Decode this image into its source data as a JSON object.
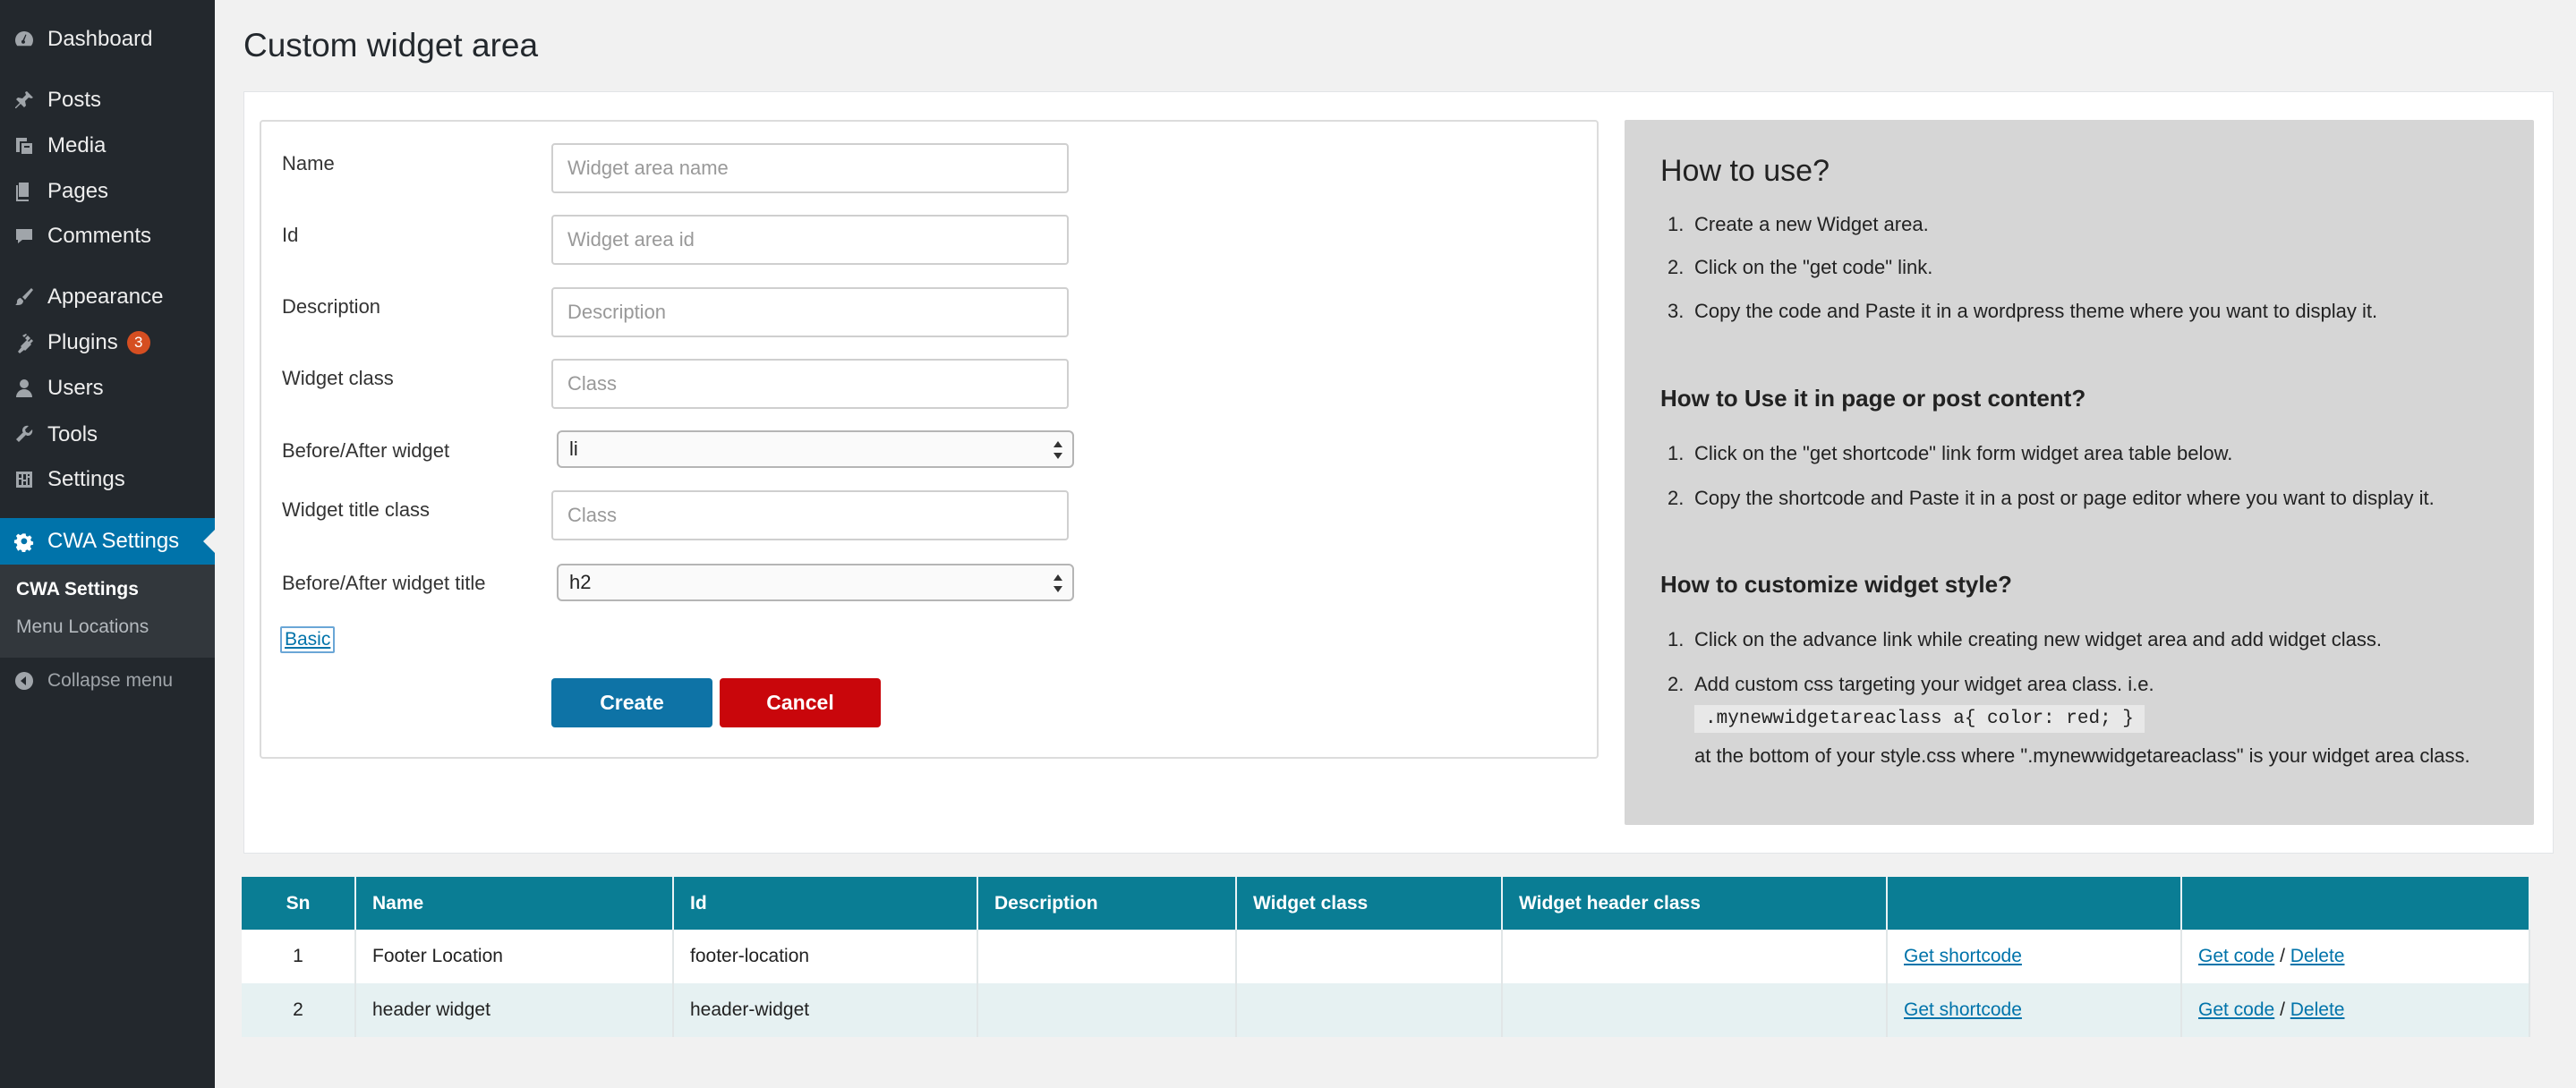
{
  "sidebar": {
    "items": [
      {
        "label": "Dashboard",
        "icon": "dashboard-icon"
      },
      {
        "label": "Posts",
        "icon": "pin-icon"
      },
      {
        "label": "Media",
        "icon": "media-icon"
      },
      {
        "label": "Pages",
        "icon": "pages-icon"
      },
      {
        "label": "Comments",
        "icon": "comment-icon"
      },
      {
        "label": "Appearance",
        "icon": "brush-icon"
      },
      {
        "label": "Plugins",
        "icon": "plugin-icon",
        "badge": "3"
      },
      {
        "label": "Users",
        "icon": "user-icon"
      },
      {
        "label": "Tools",
        "icon": "wrench-icon"
      },
      {
        "label": "Settings",
        "icon": "settings-icon"
      },
      {
        "label": "CWA Settings",
        "icon": "gear-icon"
      }
    ],
    "submenu": [
      "CWA Settings",
      "Menu Locations"
    ],
    "collapse_label": "Collapse menu",
    "accent_color": "#0073aa",
    "badge_color": "#d54e21"
  },
  "page": {
    "title": "Custom widget area"
  },
  "form": {
    "fields": [
      {
        "label": "Name",
        "placeholder": "Widget area name"
      },
      {
        "label": "Id",
        "placeholder": "Widget area id"
      },
      {
        "label": "Description",
        "placeholder": "Description"
      },
      {
        "label": "Widget class",
        "placeholder": "Class"
      },
      {
        "label": "Before/After widget",
        "value": "li"
      },
      {
        "label": "Widget title class",
        "placeholder": "Class"
      },
      {
        "label": "Before/After widget title",
        "value": "h2"
      }
    ],
    "basic_link": "Basic",
    "create_label": "Create",
    "cancel_label": "Cancel",
    "create_color": "#0e73a6",
    "cancel_color": "#c9060b"
  },
  "howto": {
    "title": "How to use?",
    "steps": [
      "Create a new Widget area.",
      "Click on the \"get code\" link.",
      "Copy the code and Paste it in a wordpress theme where you want to display it."
    ],
    "section2_title": "How to Use it in page or post content?",
    "section2_steps": [
      "Click on the \"get shortcode\" link form widget area table below.",
      "Copy the shortcode and Paste it in a post or page editor where you want to display it."
    ],
    "section3_title": "How to customize widget style?",
    "section3_steps": [
      "Click on the advance link while creating new widget area and add widget class.",
      "Add custom css targeting your widget area class. i.e."
    ],
    "code": ".mynewwidgetareaclass a{ color: red; }",
    "code_after": "at the bottom of your style.css where \".mynewwidgetareaclass\" is your widget area class."
  },
  "table": {
    "headers": [
      "Sn",
      "Name",
      "Id",
      "Description",
      "Widget class",
      "Widget header class",
      "",
      ""
    ],
    "header_color": "#0a7d94",
    "rows": [
      {
        "sn": "1",
        "name": "Footer Location",
        "id": "footer-location",
        "description": "",
        "widget_class": "",
        "widget_header_class": "",
        "shortcode": "Get shortcode",
        "code": "Get code",
        "sep": "/",
        "delete": "Delete"
      },
      {
        "sn": "2",
        "name": "header widget",
        "id": "header-widget",
        "description": "",
        "widget_class": "",
        "widget_header_class": "",
        "shortcode": "Get shortcode",
        "code": "Get code",
        "sep": "/",
        "delete": "Delete"
      }
    ]
  }
}
